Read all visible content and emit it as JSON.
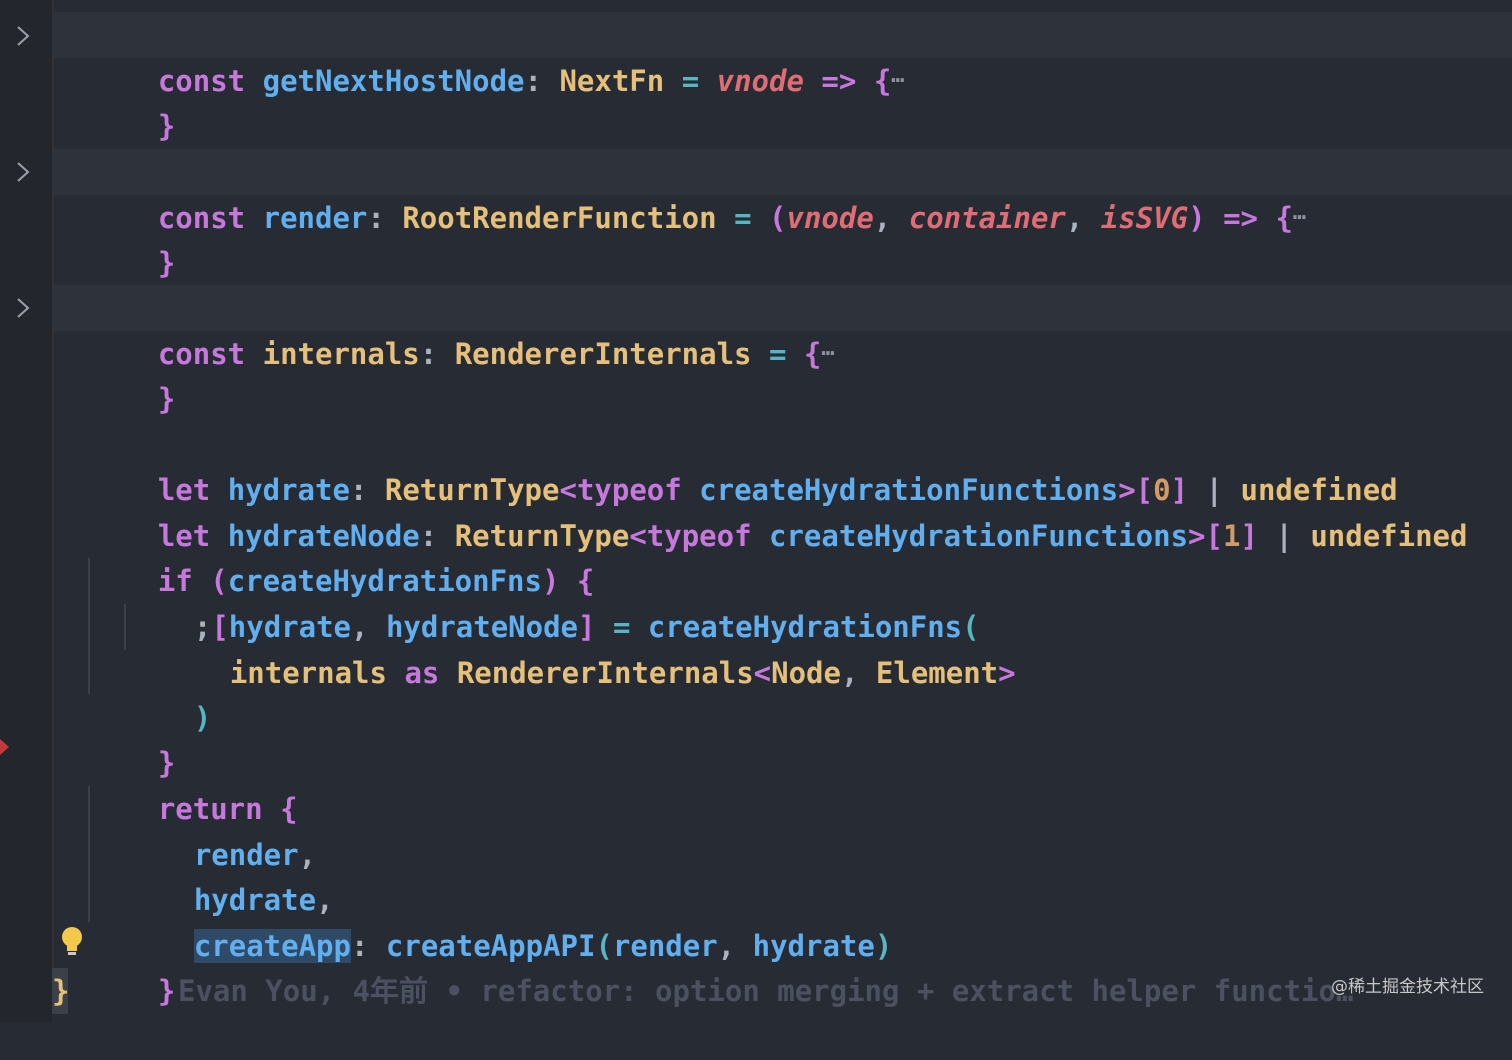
{
  "editor": {
    "lines": {
      "l1": {
        "kw": "const",
        "name": "getNextHostNode",
        "colon": ":",
        "type": "NextFn",
        "eq": "=",
        "p1": "vnode",
        "arrow": "=>",
        "brace": "{",
        "ellipsis": "⋯"
      },
      "l1close": "}",
      "l2": {
        "kw": "const",
        "name": "render",
        "colon": ":",
        "type": "RootRenderFunction",
        "eq": "=",
        "open": "(",
        "p1": "vnode",
        "c1": ",",
        "p2": "container",
        "c2": ",",
        "p3": "isSVG",
        "close": ")",
        "arrow": "=>",
        "brace": "{",
        "ellipsis": "⋯"
      },
      "l2close": "}",
      "l3": {
        "kw": "const",
        "name": "internals",
        "colon": ":",
        "type": "RendererInternals",
        "eq": "=",
        "brace": "{",
        "ellipsis": "⋯"
      },
      "l3close": "}",
      "l4": {
        "kw": "let",
        "name": "hydrate",
        "colon": ":",
        "t1": "ReturnType",
        "lt": "<",
        "typeof": "typeof",
        "fnname": "createHydrationFunctions",
        "gt": ">",
        "lb": "[",
        "idx": "0",
        "rb": "]",
        "pipe": "|",
        "undef": "undefined"
      },
      "l5": {
        "kw": "let",
        "name": "hydrateNode",
        "colon": ":",
        "t1": "ReturnType",
        "lt": "<",
        "typeof": "typeof",
        "fnname": "createHydrationFunctions",
        "gt": ">",
        "lb": "[",
        "idx": "1",
        "rb": "]",
        "pipe": "|",
        "undef": "undefined"
      },
      "l6": {
        "kw": "if",
        "open": "(",
        "cond": "createHydrationFns",
        "close": ")",
        "brace": "{"
      },
      "l7": {
        "semi": ";",
        "lb": "[",
        "a": "hydrate",
        "comma": ",",
        "b": "hydrateNode",
        "rb": "]",
        "eq": "=",
        "fn": "createHydrationFns",
        "open": "("
      },
      "l8": {
        "id": "internals",
        "as": "as",
        "type": "RendererInternals",
        "lt": "<",
        "t1": "Node",
        "comma": ",",
        "t2": "Element",
        "gt": ">"
      },
      "l9": {
        "close": ")"
      },
      "l10": {
        "close": "}"
      },
      "l11": {
        "kw": "return",
        "brace": "{"
      },
      "l12": {
        "id": "render",
        "comma": ","
      },
      "l13": {
        "id": "hydrate",
        "comma": ","
      },
      "l14": {
        "key": "createApp",
        "colon": ":",
        "fn": "createAppAPI",
        "open": "(",
        "a": "render",
        "comma": ",",
        "b": "hydrate",
        "close": ")"
      },
      "l15": {
        "close": "}"
      },
      "l16": {
        "close": "}"
      }
    },
    "blame": "Evan You, 4年前 • refactor: option merging + extract helper functio…",
    "icons": {
      "fold": "chevron-right-icon",
      "bulb": "lightbulb-icon",
      "breakpoint": "breakpoint-marker-icon"
    }
  },
  "watermark": "@稀土掘金技术社区"
}
